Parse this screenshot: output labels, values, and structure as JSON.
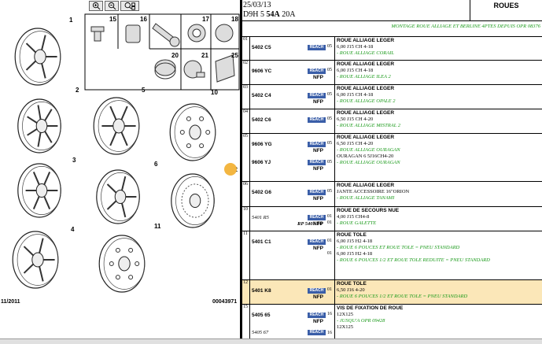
{
  "diagram": {
    "callouts": [
      "1",
      "2",
      "3",
      "4",
      "5",
      "6",
      "10",
      "11",
      "12"
    ],
    "inset_labels": [
      "15",
      "16",
      "17",
      "18",
      "20",
      "21",
      "25"
    ],
    "footer_left": "11/2011",
    "footer_right": "00043971",
    "highlight_color": "#f3b641"
  },
  "header": {
    "date": "25/03/13",
    "model_prefix": "D9H 5 ",
    "model_bold": "54A",
    "model_suffix": " 20A",
    "title": "ROUES"
  },
  "section_title": "MONTAGE ROUE ALLIAGE ET BERLINE 4PTES DEPUIS OPR 08376",
  "reach_label": "REACH",
  "nfp_label": "NFP",
  "rows": [
    {
      "num": "01",
      "ref": "5402 C5",
      "qty": "05",
      "lines": [
        "ROUE ALLIAGE LEGER",
        "6,00 J15 CH 4-18",
        "- ROUE ALLIAGE CORAIL"
      ]
    },
    {
      "num": "02",
      "ref": "9606 YC",
      "qty": "05",
      "lines": [
        "ROUE ALLIAGE LEGER",
        "6,00 J15 CH 4-18",
        "- ROUE ALLIAGE ILEA 2"
      ]
    },
    {
      "num": "03",
      "ref": "5402 C4",
      "qty": "05",
      "lines": [
        "ROUE ALLIAGE LEGER",
        "6,00 J15 CH 4-18",
        "- ROUE ALLIAGE OPALE 2"
      ]
    },
    {
      "num": "04",
      "ref": "5402 C6",
      "qty": "05",
      "lines": [
        "ROUE ALLIAGE LEGER",
        "6,50 J15 CH 4-20",
        "- ROUE ALLIAGE MISTRAL 2"
      ]
    },
    {
      "num": "05",
      "ref": "9606 YG",
      "ref2": "9606 YJ",
      "qty": "05",
      "qty2": "05",
      "lines": [
        "ROUE ALLIAGE LEGER",
        "6,50 J15 CH 4-20",
        "- ROUE ALLIAGE OURAGAN",
        "OURAGAN 6 5J16CH4-20",
        "- ROUE ALLIAGE OURAGAN"
      ]
    },
    {
      "num": "06",
      "ref": "5402 G6",
      "qty": "05",
      "lines": [
        "ROUE ALLIAGE LEGER",
        "JANTE ACCESSOIRE 16\"ORION",
        "- ROUE ALLIAGE TANAMI"
      ]
    },
    {
      "num": "10",
      "ref": "5401 R5",
      "rp": "RP 5401 T0",
      "qty": "01",
      "qty2": "01",
      "lines": [
        "ROUE DE SECOURS NUE",
        "4,00 J15 CH4-8",
        "- ROUE GALETTE"
      ]
    },
    {
      "num": "11",
      "ref": "5401 C1",
      "qty": "01",
      "qty2": "01",
      "lines": [
        "ROUE TOLE",
        "6,00 J15 H2 4-18",
        "- ROUE 6 POUCES ET ROUE TOLE = PNEU STANDARD",
        "6,00 J15 H2 4-18",
        "- ROUE 6 POUCES 1/2 ET ROUE TOLE REDUITE = PNEU STANDARD"
      ]
    },
    {
      "num": "12",
      "ref": "5401 K8",
      "qty": "01",
      "lines": [
        "ROUE TOLE",
        "6,50 J16 4-20",
        "- ROUE 6 POUCES 1/2 ET ROUE TOLE = PNEU STANDARD"
      ]
    },
    {
      "num": "15",
      "ref": "5405 65",
      "ref2": "5405 67",
      "qty": "16",
      "qty2": "16",
      "lines": [
        "VIS DE FIXATION DE ROUE",
        "12X125",
        "- JUSQU'A OPR 09428",
        "12X125"
      ]
    }
  ]
}
